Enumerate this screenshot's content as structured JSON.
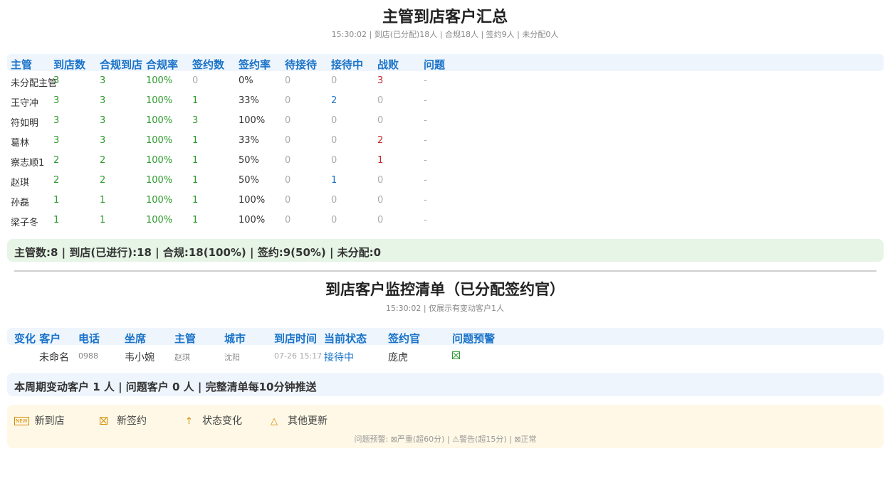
{
  "summary": {
    "title": "主管到店客户汇总",
    "subtitle": "15:30:02 | 到店(已分配)18人 | 合规18人 | 签约9人 | 未分配0人",
    "headers": [
      "主管",
      "到店数",
      "合规到店",
      "合规率",
      "签约数",
      "签约率",
      "待接待",
      "接待中",
      "战败",
      "问题"
    ],
    "rows": [
      [
        "未分配主管",
        "3",
        "3",
        "100%",
        "0",
        "0%",
        "0",
        "0",
        "3",
        "-"
      ],
      [
        "王守冲",
        "3",
        "3",
        "100%",
        "1",
        "33%",
        "0",
        "2",
        "0",
        "-"
      ],
      [
        "符如明",
        "3",
        "3",
        "100%",
        "3",
        "100%",
        "0",
        "0",
        "0",
        "-"
      ],
      [
        "葛林",
        "3",
        "3",
        "100%",
        "1",
        "33%",
        "0",
        "0",
        "2",
        "-"
      ],
      [
        "察志顺1",
        "2",
        "2",
        "100%",
        "1",
        "50%",
        "0",
        "0",
        "1",
        "-"
      ],
      [
        "赵琪",
        "2",
        "2",
        "100%",
        "1",
        "50%",
        "0",
        "1",
        "0",
        "-"
      ],
      [
        "孙磊",
        "1",
        "1",
        "100%",
        "1",
        "100%",
        "0",
        "0",
        "0",
        "-"
      ],
      [
        "梁子冬",
        "1",
        "1",
        "100%",
        "1",
        "100%",
        "0",
        "0",
        "0",
        "-"
      ]
    ],
    "footer": "主管数:8 | 到店(已进行):18 | 合规:18(100%) | 签约:9(50%) | 未分配:0"
  },
  "monitor": {
    "title": "到店客户监控清单（已分配签约官）",
    "subtitle": "15:30:02 | 仅展示有变动客户1人",
    "headers": [
      "变化",
      "客户",
      "电话",
      "坐席",
      "主管",
      "城市",
      "到店时间",
      "当前状态",
      "签约官",
      "问题预警"
    ],
    "row": {
      "customer": "未命名",
      "phone": "0988",
      "agent": "韦小婉",
      "supervisor": "赵琪",
      "city": "沈阳",
      "time": "07-26 15:17",
      "status": "接待中",
      "signer": "庞虎",
      "warning_icon": "x-box-icon"
    },
    "footer": "本周期变动客户 1 人 | 问题客户 0 人 | 完整清单每10分钟推送"
  },
  "legend": {
    "items": [
      {
        "icon": "new-icon",
        "label": "新到店"
      },
      {
        "icon": "x-box-icon",
        "label": "新签约"
      },
      {
        "icon": "up-arrow-icon",
        "label": "状态变化"
      },
      {
        "icon": "triangle-icon",
        "label": "其他更新"
      }
    ],
    "note": "问题预警: ⊠严重(超60分) | ⚠警告(超15分) | ⊠正常"
  },
  "colors": {
    "accent": "#1a73c8",
    "good": "#2e9a2e",
    "bad": "#c62828",
    "muted": "#aaaaaa",
    "legend_bg": "#fff8e6",
    "summary_bg": "#e6f5e6"
  }
}
